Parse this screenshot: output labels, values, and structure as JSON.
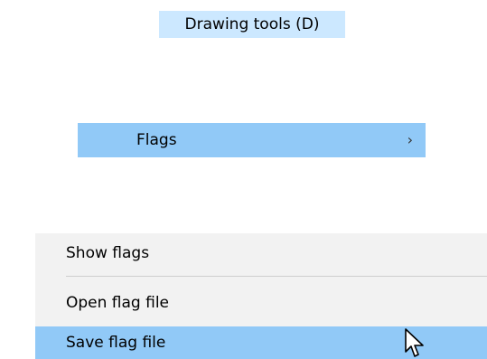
{
  "drawing_tools": {
    "label": "Drawing tools (D)",
    "bg_color": "#cce8ff"
  },
  "flags_menu": {
    "label": "Flags",
    "chevron": "›",
    "highlight_color": "#91c9f7"
  },
  "context_menu": {
    "items": [
      {
        "label": "Show flags",
        "selected": false
      },
      {
        "label": "Open flag file",
        "selected": false
      },
      {
        "label": "Save flag file",
        "selected": true
      }
    ],
    "bg_color": "#f2f2f2",
    "selected_color": "#91c9f7"
  },
  "cursor": {
    "icon": "arrow-cursor-icon"
  }
}
